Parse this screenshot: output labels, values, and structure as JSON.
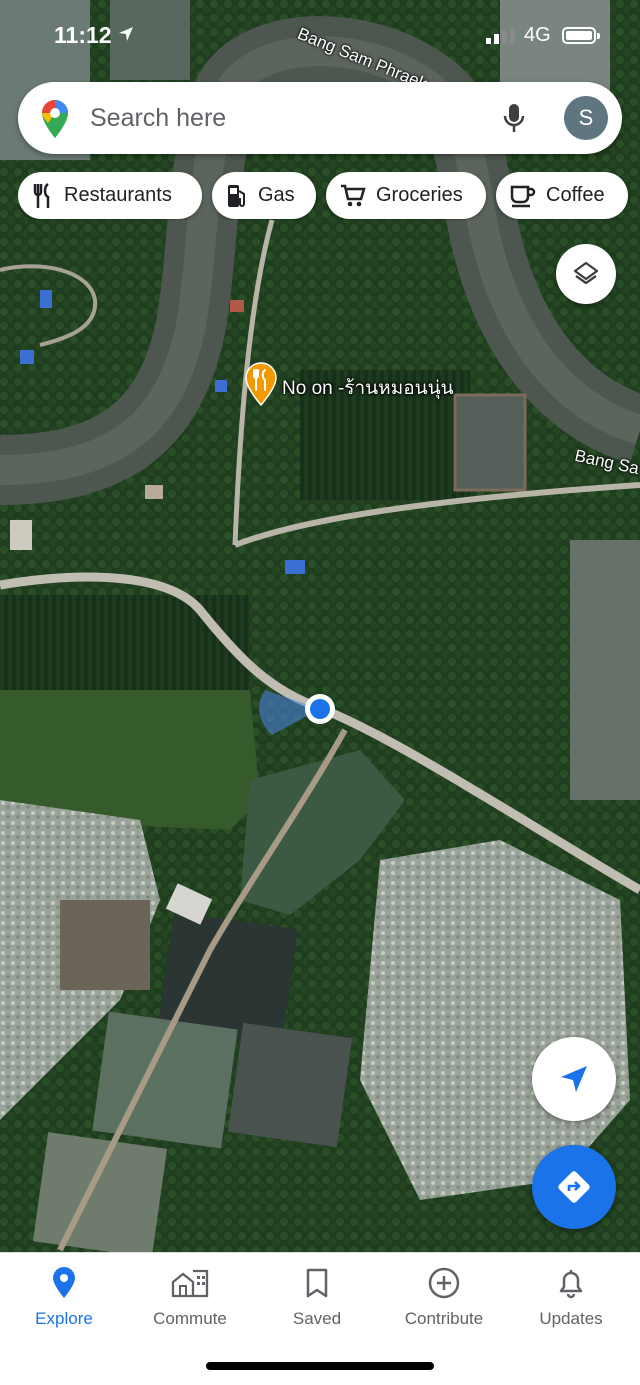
{
  "status_bar": {
    "time": "11:12",
    "network": "4G"
  },
  "search": {
    "placeholder": "Search here",
    "avatar_letter": "S"
  },
  "chips": [
    {
      "label": "Restaurants",
      "icon": "fork-knife-icon"
    },
    {
      "label": "Gas",
      "icon": "gas-pump-icon"
    },
    {
      "label": "Groceries",
      "icon": "cart-icon"
    },
    {
      "label": "Coffee",
      "icon": "coffee-cup-icon"
    }
  ],
  "map": {
    "road_labels": [
      "Bang Sam Phraek",
      "Bang Sa"
    ],
    "poi": {
      "name": "No on -ร้านหมอนนุ่น",
      "type": "restaurant"
    }
  },
  "bottom_nav": [
    {
      "label": "Explore",
      "icon": "location-pin-icon",
      "active": true
    },
    {
      "label": "Commute",
      "icon": "commute-icon",
      "active": false
    },
    {
      "label": "Saved",
      "icon": "bookmark-icon",
      "active": false
    },
    {
      "label": "Contribute",
      "icon": "add-circle-icon",
      "active": false
    },
    {
      "label": "Updates",
      "icon": "bell-icon",
      "active": false
    }
  ],
  "colors": {
    "accent": "#1a73e8",
    "poi": "#f29900"
  }
}
